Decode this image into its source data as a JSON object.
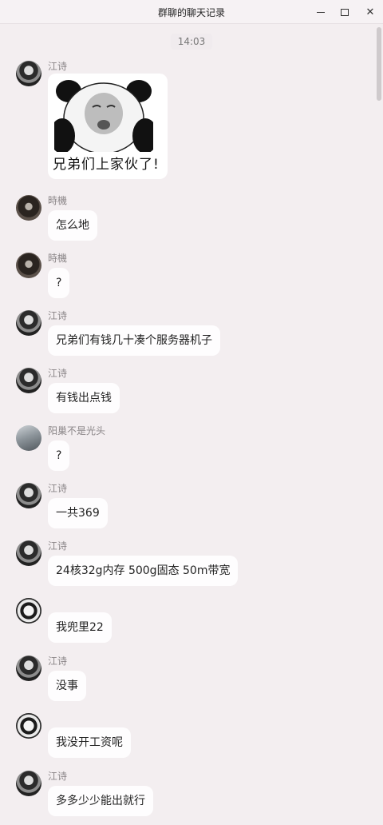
{
  "window": {
    "title": "群聊的聊天记录",
    "minimize_glyph": "",
    "close_glyph": "✕"
  },
  "timestamp": "14:03",
  "messages": [
    {
      "sender": "江诗",
      "avatar": "jiang-avatar",
      "type": "sticker",
      "sticker_text": "兄弟们上家伙了!"
    },
    {
      "sender": "時機",
      "avatar": "shiji-avatar",
      "type": "text",
      "text": "怎么地"
    },
    {
      "sender": "時機",
      "avatar": "shiji-avatar",
      "type": "text",
      "text": "?"
    },
    {
      "sender": "江诗",
      "avatar": "jiang-avatar",
      "type": "text",
      "text": "兄弟们有钱几十凑个服务器机子"
    },
    {
      "sender": "江诗",
      "avatar": "jiang-avatar",
      "type": "text",
      "text": "有钱出点钱"
    },
    {
      "sender": "阳巢不是光头",
      "avatar": "yang-avatar",
      "type": "text",
      "text": "?"
    },
    {
      "sender": "江诗",
      "avatar": "jiang-avatar",
      "type": "text",
      "text": "一共369"
    },
    {
      "sender": "江诗",
      "avatar": "jiang-avatar",
      "type": "text",
      "text": "24核32g内存 500g固态 50m带宽"
    },
    {
      "sender": "",
      "avatar": "boy-avatar",
      "type": "text",
      "text": "我兜里22"
    },
    {
      "sender": "江诗",
      "avatar": "jiang-avatar",
      "type": "text",
      "text": "没事"
    },
    {
      "sender": "",
      "avatar": "boy-avatar",
      "type": "text",
      "text": "我没开工资呢"
    },
    {
      "sender": "江诗",
      "avatar": "jiang-avatar",
      "type": "text",
      "text": "多多少少能出就行"
    }
  ]
}
